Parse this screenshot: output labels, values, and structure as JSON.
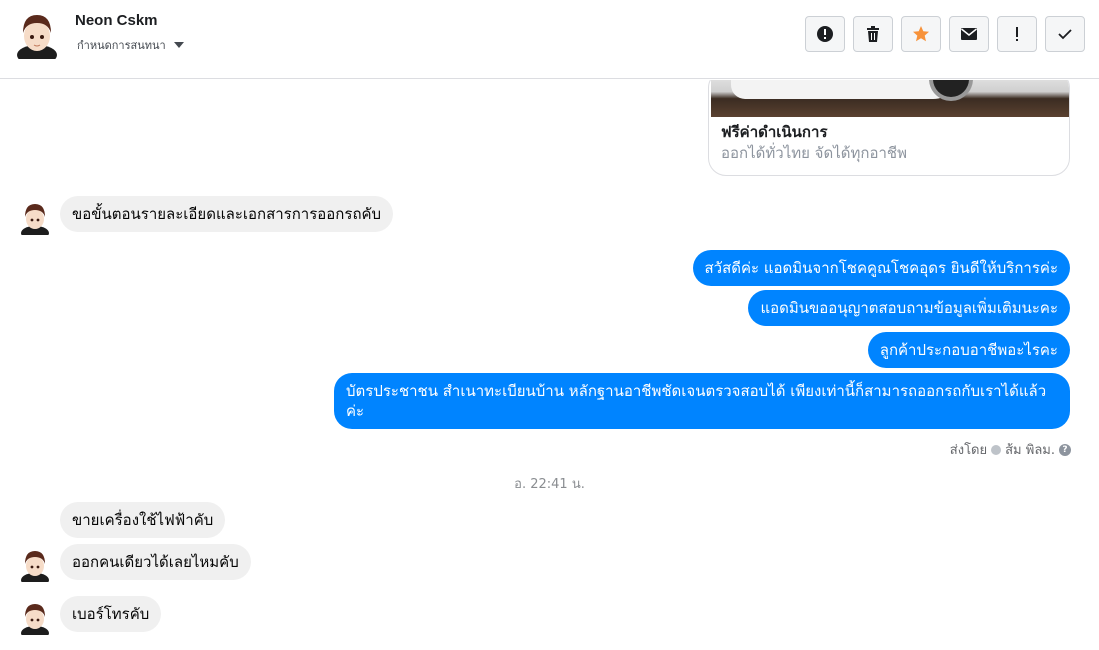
{
  "header": {
    "name": "Neon Cskm",
    "subtitle": "กำหนดการสนทนา"
  },
  "toolbar": {
    "buttons": [
      {
        "icon": "alert-circle-icon"
      },
      {
        "icon": "trash-icon"
      },
      {
        "icon": "star-icon",
        "color": "#f7923a"
      },
      {
        "icon": "envelope-icon"
      },
      {
        "icon": "exclamation-icon"
      },
      {
        "icon": "checkmark-icon"
      }
    ]
  },
  "card": {
    "title": "ฟรีค่าดำเนินการ",
    "subtitle": "ออกได้ทั่วไทย จัดได้ทุกอาชีพ"
  },
  "messages": {
    "in1": "ขอขั้นตอนรายละเอียดและเอกสารการออกรถคับ",
    "out1": "สวัสดีค่ะ แอดมินจากโชคคูณโชคอุดร ยินดีให้บริการค่ะ",
    "out2": "แอดมินขออนุญาตสอบถามข้อมูลเพิ่มเติมนะคะ",
    "out3": "ลูกค้าประกอบอาชีพอะไรคะ",
    "out4": "บัตรประชาชน สำเนาทะเบียนบ้าน หลักฐานอาชีพชัดเจนตรวจสอบได้ เพียงเท่านี้ก็สามารถออกรถกับเราได้แล้วค่ะ",
    "in2": "ขายเครื่องใช้ไฟฟ้าคับ",
    "in3": "ออกคนเดียวได้เลยไหมคับ",
    "in4": "เบอร์โทรคับ"
  },
  "sent_by": {
    "prefix": "ส่งโดย",
    "name": "ส้ม พิลม."
  },
  "timestamp": "อ. 22:41 น.",
  "colors": {
    "outgoing_bubble": "#0084ff",
    "incoming_bubble": "#f0f0f0",
    "star": "#f7923a"
  }
}
